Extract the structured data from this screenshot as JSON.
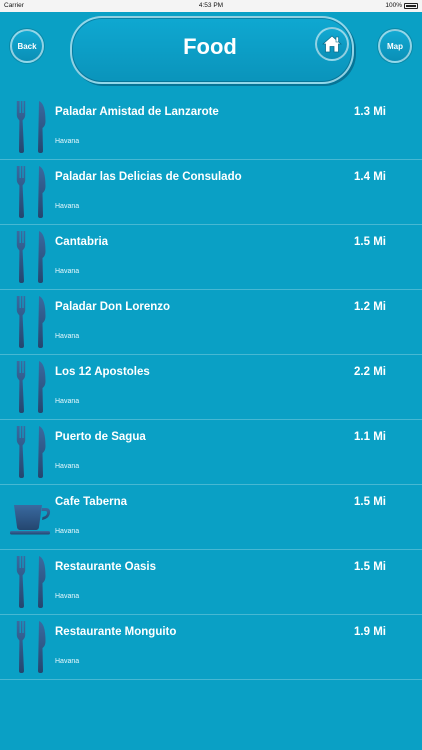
{
  "status_bar": {
    "carrier": "Carrier",
    "time": "4:53 PM",
    "battery": "100%"
  },
  "header": {
    "back_label": "Back",
    "title": "Food",
    "map_label": "Map",
    "home_icon": "home-icon"
  },
  "colors": {
    "background": "#0aa0c5",
    "icon": "#2e5a8a"
  },
  "places": [
    {
      "name": "Paladar Amistad de Lanzarote",
      "city": "Havana",
      "distance": "1.3 Mi",
      "icon": "fork-knife-icon"
    },
    {
      "name": "Paladar las Delicias de Consulado",
      "city": "Havana",
      "distance": "1.4 Mi",
      "icon": "fork-knife-icon"
    },
    {
      "name": "Cantabria",
      "city": "Havana",
      "distance": "1.5 Mi",
      "icon": "fork-knife-icon"
    },
    {
      "name": "Paladar Don Lorenzo",
      "city": "Havana",
      "distance": "1.2 Mi",
      "icon": "fork-knife-icon"
    },
    {
      "name": "Los 12 Apostoles",
      "city": "Havana",
      "distance": "2.2 Mi",
      "icon": "fork-knife-icon"
    },
    {
      "name": "Puerto de Sagua",
      "city": "Havana",
      "distance": "1.1 Mi",
      "icon": "fork-knife-icon"
    },
    {
      "name": "Cafe Taberna",
      "city": "Havana",
      "distance": "1.5 Mi",
      "icon": "coffee-cup-icon"
    },
    {
      "name": "Restaurante Oasis",
      "city": "Havana",
      "distance": "1.5 Mi",
      "icon": "fork-knife-icon"
    },
    {
      "name": "Restaurante Monguito",
      "city": "Havana",
      "distance": "1.9 Mi",
      "icon": "fork-knife-icon"
    }
  ]
}
